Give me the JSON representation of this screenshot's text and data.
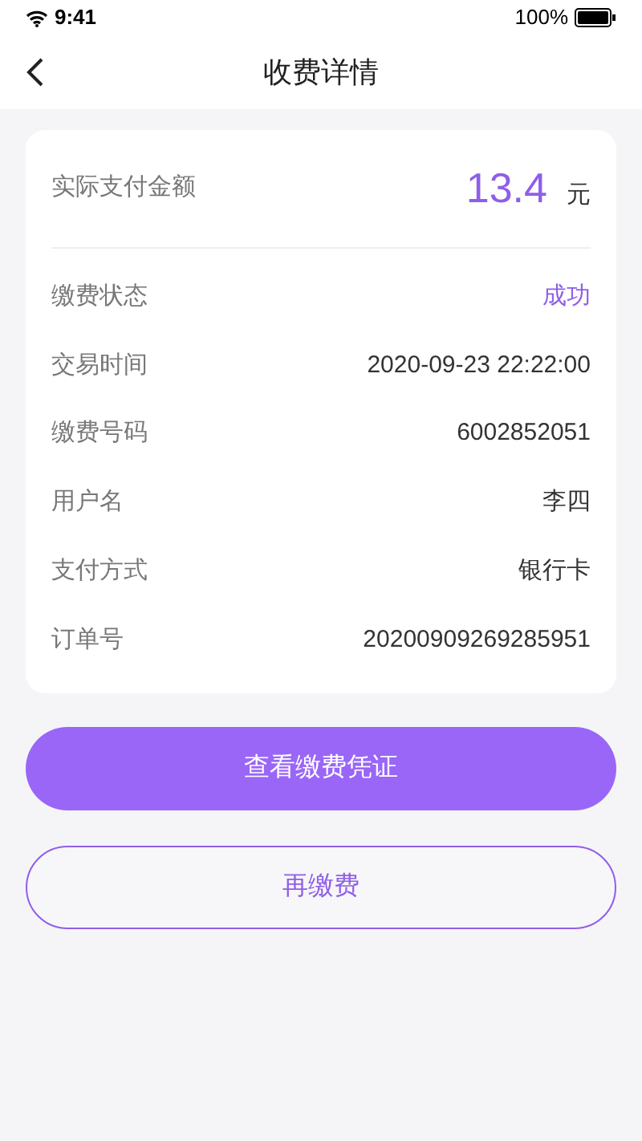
{
  "status_bar": {
    "time": "9:41",
    "battery": "100%"
  },
  "nav": {
    "title": "收费详情"
  },
  "amount": {
    "label": "实际支付金额",
    "value": "13.4",
    "unit": "元"
  },
  "details": [
    {
      "label": "缴费状态",
      "value": "成功",
      "kind": "status"
    },
    {
      "label": "交易时间",
      "value": "2020-09-23 22:22:00",
      "kind": "plain"
    },
    {
      "label": "缴费号码",
      "value": "6002852051",
      "kind": "plain"
    },
    {
      "label": "用户名",
      "value": "李四",
      "kind": "plain"
    },
    {
      "label": "支付方式",
      "value": "银行卡",
      "kind": "plain"
    },
    {
      "label": "订单号",
      "value": "20200909269285951",
      "kind": "plain"
    }
  ],
  "buttons": [
    {
      "label": "查看缴费凭证",
      "kind": "primary"
    },
    {
      "label": "再缴费",
      "kind": "outline"
    }
  ]
}
